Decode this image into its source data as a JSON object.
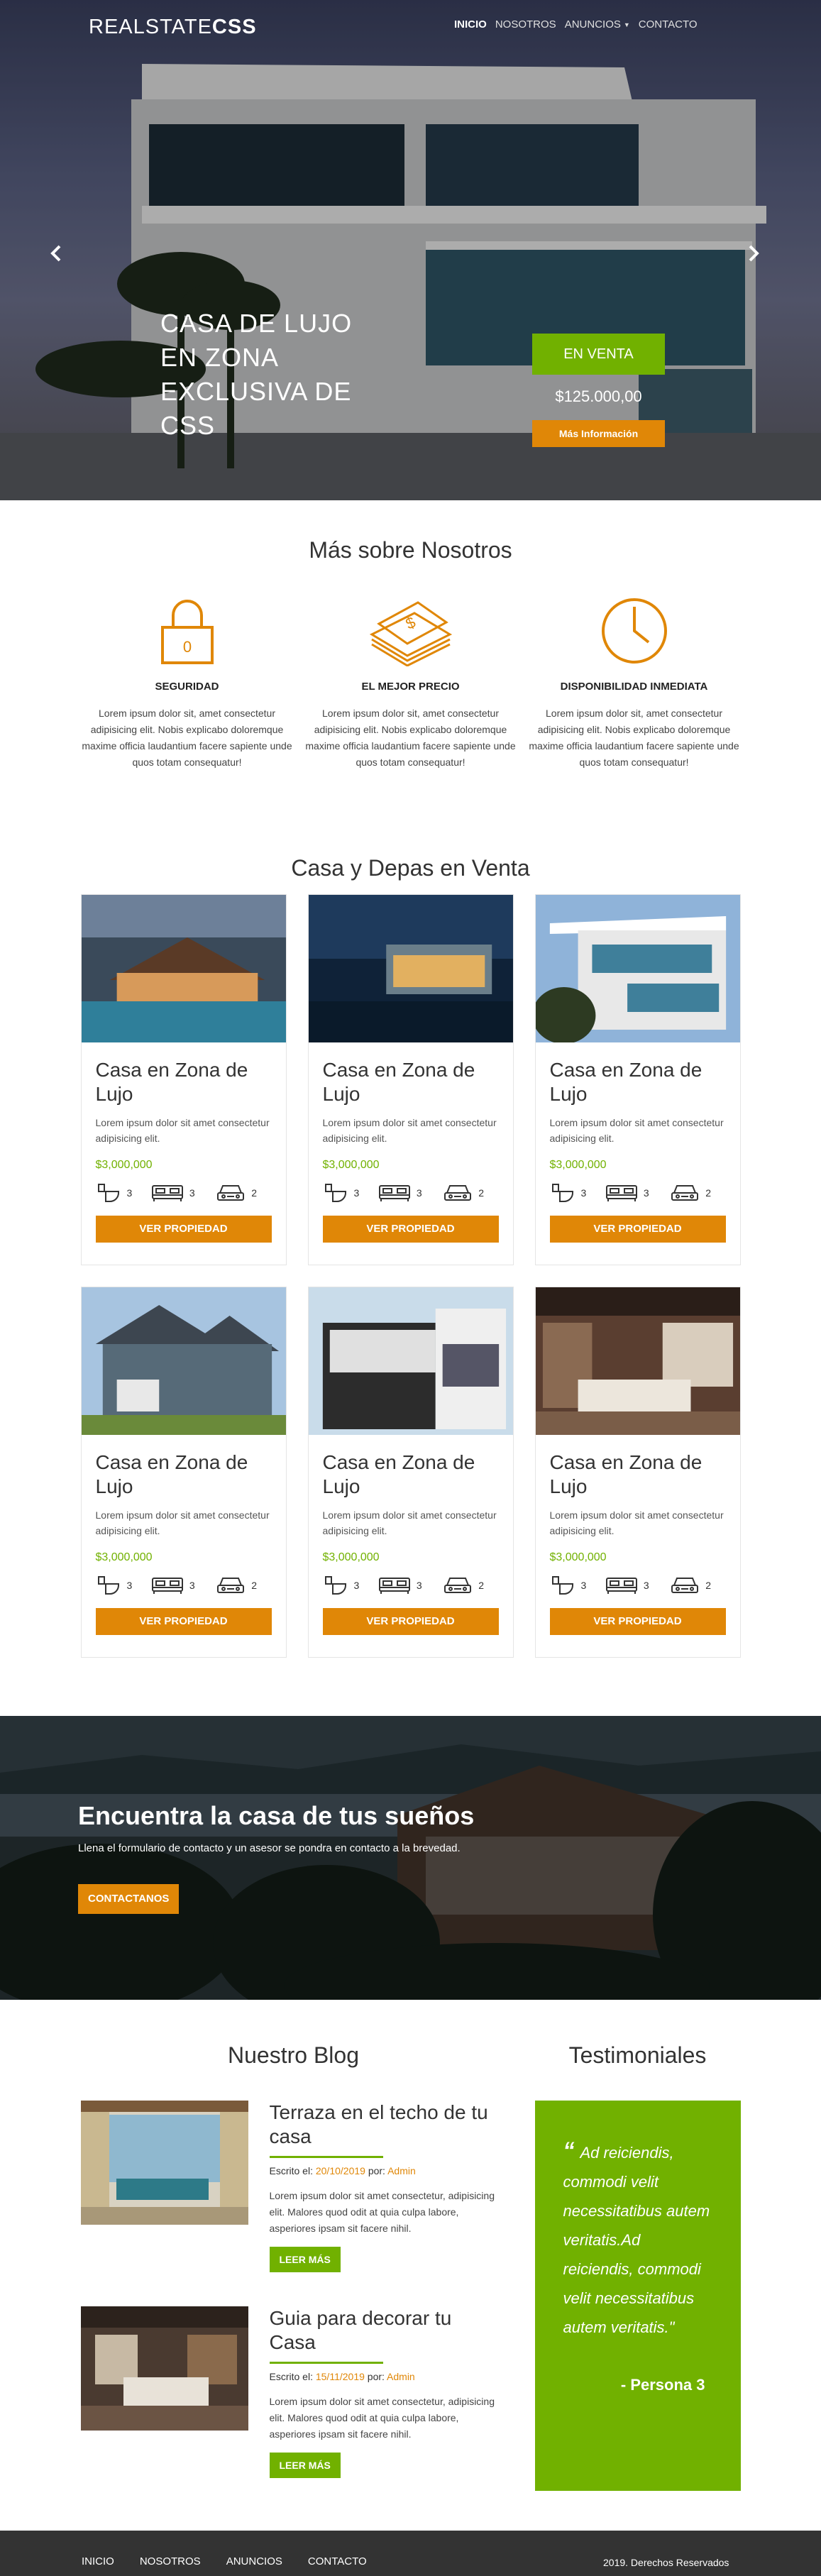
{
  "header": {
    "logo_light": "REALSTATE",
    "logo_bold": "CSS",
    "nav": [
      {
        "label": "INICIO",
        "active": true
      },
      {
        "label": "NOSOTROS",
        "active": false
      },
      {
        "label": "ANUNCIOS",
        "active": false,
        "dropdown": true
      },
      {
        "label": "CONTACTO",
        "active": false
      }
    ]
  },
  "hero": {
    "title": "CASA DE LUJO EN ZONA EXCLUSIVA DE CSS",
    "status": "EN VENTA",
    "price": "$125.000,00",
    "button": "Más Información",
    "prev_icon": "chevron-left-icon",
    "next_icon": "chevron-right-icon"
  },
  "about": {
    "title": "Más sobre Nosotros",
    "features": [
      {
        "icon": "padlock-icon",
        "title": "SEGURIDAD",
        "text": "Lorem ipsum dolor sit, amet consectetur adipisicing elit. Nobis explicabo doloremque maxime officia laudantium facere sapiente unde quos totam consequatur!"
      },
      {
        "icon": "money-stack-icon",
        "title": "EL MEJOR PRECIO",
        "text": "Lorem ipsum dolor sit, amet consectetur adipisicing elit. Nobis explicabo doloremque maxime officia laudantium facere sapiente unde quos totam consequatur!"
      },
      {
        "icon": "clock-icon",
        "title": "DISPONIBILIDAD INMEDIATA",
        "text": "Lorem ipsum dolor sit, amet consectetur adipisicing elit. Nobis explicabo doloremque maxime officia laudantium facere sapiente unde quos totam consequatur!"
      }
    ]
  },
  "listings": {
    "title": "Casa y Depas en Venta",
    "cards": [
      {
        "title": "Casa en Zona de Lujo",
        "text": "Lorem ipsum dolor sit amet consectetur adipisicing elit.",
        "price": "$3,000,000",
        "baths": "3",
        "beds": "3",
        "parking": "2",
        "button": "VER PROPIEDAD"
      },
      {
        "title": "Casa en Zona de Lujo",
        "text": "Lorem ipsum dolor sit amet consectetur adipisicing elit.",
        "price": "$3,000,000",
        "baths": "3",
        "beds": "3",
        "parking": "2",
        "button": "VER PROPIEDAD"
      },
      {
        "title": "Casa en Zona de Lujo",
        "text": "Lorem ipsum dolor sit amet consectetur adipisicing elit.",
        "price": "$3,000,000",
        "baths": "3",
        "beds": "3",
        "parking": "2",
        "button": "VER PROPIEDAD"
      },
      {
        "title": "Casa en Zona de Lujo",
        "text": "Lorem ipsum dolor sit amet consectetur adipisicing elit.",
        "price": "$3,000,000",
        "baths": "3",
        "beds": "3",
        "parking": "2",
        "button": "VER PROPIEDAD"
      },
      {
        "title": "Casa en Zona de Lujo",
        "text": "Lorem ipsum dolor sit amet consectetur adipisicing elit.",
        "price": "$3,000,000",
        "baths": "3",
        "beds": "3",
        "parking": "2",
        "button": "VER PROPIEDAD"
      },
      {
        "title": "Casa en Zona de Lujo",
        "text": "Lorem ipsum dolor sit amet consectetur adipisicing elit.",
        "price": "$3,000,000",
        "baths": "3",
        "beds": "3",
        "parking": "2",
        "button": "VER PROPIEDAD"
      }
    ]
  },
  "cta": {
    "title": "Encuentra la casa de tus sueños",
    "text": "Llena el formulario de contacto y un asesor se pondra en contacto a la brevedad.",
    "button": "CONTACTANOS"
  },
  "blog": {
    "title": "Nuestro Blog",
    "posts": [
      {
        "title": "Terraza en el techo de tu casa",
        "meta_prefix": "Escrito el: ",
        "date": "20/10/2019",
        "meta_mid": " por: ",
        "author": "Admin",
        "text": "Lorem ipsum dolor sit amet consectetur, adipisicing elit. Malores quod odit at quia culpa labore, asperiores ipsam sit facere nihil.",
        "button": "LEER MÁS"
      },
      {
        "title": "Guia para decorar tu Casa",
        "meta_prefix": "Escrito el: ",
        "date": "15/11/2019",
        "meta_mid": " por: ",
        "author": "Admin",
        "text": "Lorem ipsum dolor sit amet consectetur, adipisicing elit. Malores quod odit at quia culpa labore, asperiores ipsam sit facere nihil.",
        "button": "LEER MÁS"
      }
    ]
  },
  "testimonials": {
    "title": "Testimoniales",
    "quote_mark": "“",
    "quote": "Ad reiciendis, commodi velit necessitatibus autem veritatis.Ad reiciendis, commodi velit necessitatibus autem veritatis.\"",
    "author": "- Persona 3"
  },
  "footer": {
    "nav": [
      "INICIO",
      "NOSOTROS",
      "ANUNCIOS",
      "CONTACTO"
    ],
    "copyright": "2019. Derechos Reservados"
  },
  "colors": {
    "green": "#71b100",
    "orange": "#e08707",
    "footer": "#333333"
  }
}
